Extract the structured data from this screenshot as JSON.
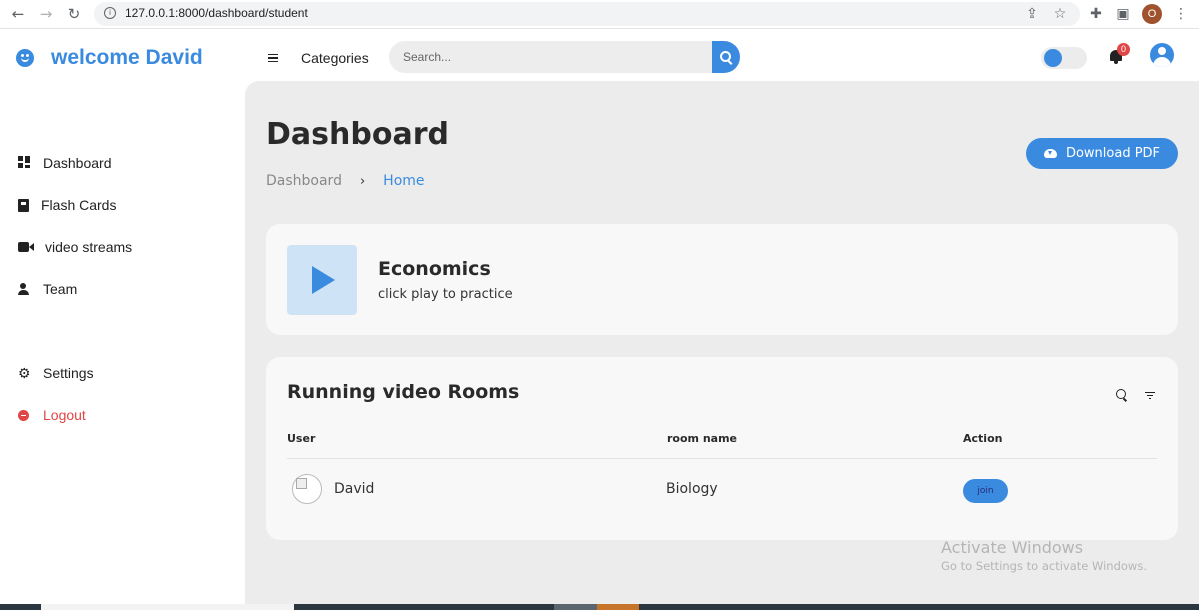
{
  "browser": {
    "url": "127.0.0.1:8000/dashboard/student",
    "profile_initial": "O",
    "icons": [
      "back-icon",
      "forward-icon",
      "reload-icon",
      "info-icon",
      "share-icon",
      "star-icon",
      "extensions-icon",
      "sidepanel-icon",
      "menu-dots-icon"
    ]
  },
  "sidebar": {
    "brand": "welcome David",
    "items": [
      {
        "label": "Dashboard",
        "icon": "grid-icon"
      },
      {
        "label": "Flash Cards",
        "icon": "book-icon"
      },
      {
        "label": "video streams",
        "icon": "video-icon"
      },
      {
        "label": "Team",
        "icon": "team-icon"
      }
    ],
    "settings_label": "Settings",
    "logout_label": "Logout"
  },
  "topbar": {
    "categories_label": "Categories",
    "search_placeholder": "Search...",
    "notification_count": "0"
  },
  "main": {
    "title": "Dashboard",
    "breadcrumb": [
      "Dashboard",
      "Home"
    ],
    "breadcrumb_separator": "›",
    "download_label": "Download PDF",
    "course": {
      "title": "Economics",
      "subtitle": "click play to practice"
    },
    "rooms": {
      "title": "Running video Rooms",
      "columns": [
        "User",
        "room name",
        "Action"
      ],
      "rows": [
        {
          "user": "David",
          "room": "Biology",
          "action": "join"
        }
      ]
    }
  },
  "os": {
    "watermark_title": "Activate Windows",
    "watermark_sub": "Go to Settings to activate Windows."
  },
  "colors": {
    "accent": "#3a8be0",
    "danger": "#e04646",
    "main_bg": "#ececec",
    "card_bg": "#f8f8f8"
  }
}
